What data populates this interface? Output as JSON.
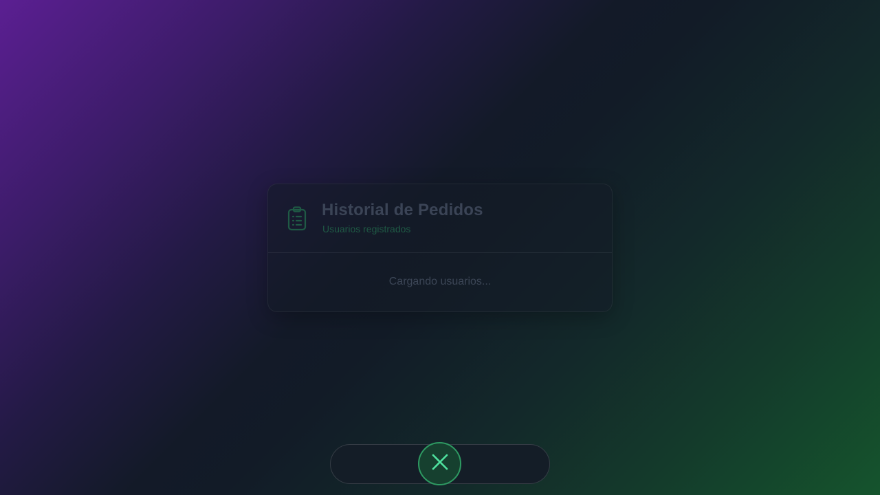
{
  "card": {
    "title": "Historial de Pedidos",
    "subtitle": "Usuarios registrados",
    "header_icon": "clipboard-list-icon",
    "loading_text": "Cargando usuarios..."
  },
  "bottom_bar": {
    "close_icon": "close-icon"
  },
  "colors": {
    "accent_green": "#2e9a62",
    "background_purple": "#5b1f92",
    "background_green": "#15542d"
  }
}
